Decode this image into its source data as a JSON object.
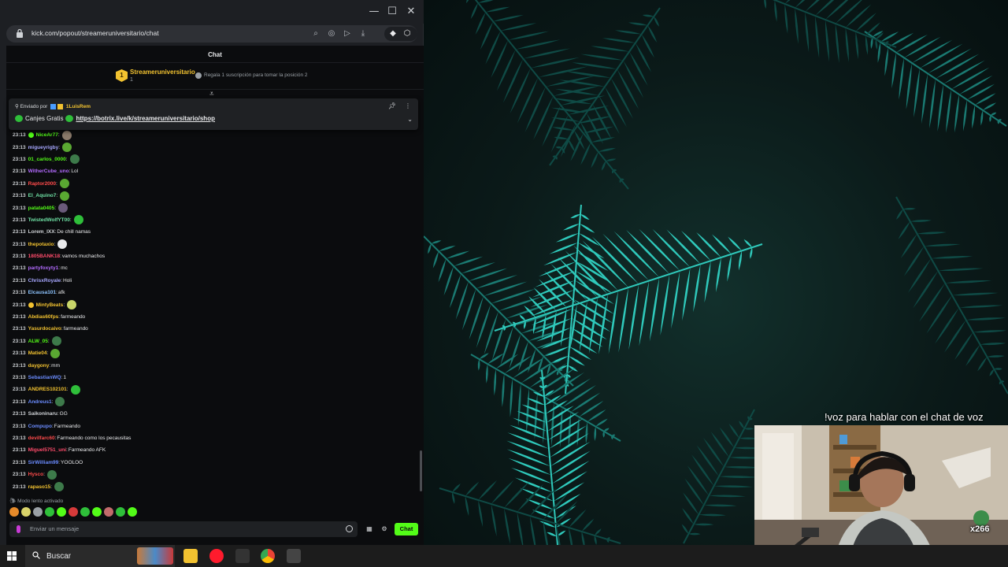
{
  "window": {
    "minimize_glyph": "—",
    "maximize_glyph": "☐",
    "close_glyph": "✕",
    "url": "kick.com/popout/streameruniversitario/chat"
  },
  "chat": {
    "title": "Chat",
    "leaderboard": {
      "rank": "1",
      "name": "Streameruniversitario",
      "count": "1",
      "gift_text": "Regala 1 suscripción para tomar la posición 2"
    },
    "pinned": {
      "sent_by": "Enviado por",
      "user": "1LuisRem",
      "label": "Canjes Gratis",
      "link": "https://botrix.live/k/streameruniversitario/shop"
    },
    "messages": [
      {
        "time": "23:13",
        "user": "NiceAr77",
        "text": "",
        "color": "#53fc18",
        "emote": "#8a7a6a",
        "badge": "#53fc18"
      },
      {
        "time": "23:13",
        "user": "migueyrigby",
        "text": "",
        "color": "#a7a7ff",
        "emote": "#5aa832"
      },
      {
        "time": "23:13",
        "user": "01_carlos_0000",
        "text": "",
        "color": "#53fc18",
        "emote": "#3d7a4a"
      },
      {
        "time": "23:13",
        "user": "WitherCube_uno",
        "text": "Lol",
        "color": "#b36bff",
        "emote": ""
      },
      {
        "time": "23:13",
        "user": "Raptor2000",
        "text": "",
        "color": "#ff4b4b",
        "emote": "#5aa832"
      },
      {
        "time": "23:13",
        "user": "El_Aquino7",
        "text": "",
        "color": "#6fe2a5",
        "emote": "#5aa832"
      },
      {
        "time": "23:13",
        "user": "patata0405",
        "text": "",
        "color": "#53fc18",
        "emote": "#6a5a7a"
      },
      {
        "time": "23:13",
        "user": "TwistedWolfYT00",
        "text": "",
        "color": "#6fe2a5",
        "emote": "#2fbf3a"
      },
      {
        "time": "23:13",
        "user": "Lorem_IXX",
        "text": "De chill namas",
        "color": "#cfd2d6",
        "emote": ""
      },
      {
        "time": "23:13",
        "user": "thepotaxio",
        "text": "",
        "color": "#f2c230",
        "emote": "#e9eaec"
      },
      {
        "time": "23:13",
        "user": "1805BANK18",
        "text": "vamos muchachos",
        "color": "#ff4b6b",
        "emote": ""
      },
      {
        "time": "23:13",
        "user": "partyfoxyty1",
        "text": "mc",
        "color": "#b36bff",
        "emote": ""
      },
      {
        "time": "23:13",
        "user": "ChrisxRoyale",
        "text": "Holi",
        "color": "#a7a7ff",
        "emote": ""
      },
      {
        "time": "23:13",
        "user": "Elcausa101",
        "text": "afk",
        "color": "#8ec5ff",
        "emote": ""
      },
      {
        "time": "23:13",
        "user": "MintyBeats",
        "text": "",
        "color": "#f2c230",
        "emote": "#c9d66a",
        "badge": "#f2c230"
      },
      {
        "time": "23:13",
        "user": "Abdias60fps",
        "text": "farmeando",
        "color": "#f2c230",
        "emote": ""
      },
      {
        "time": "23:13",
        "user": "Yasurdocaivo",
        "text": "farmeando",
        "color": "#f2c230",
        "emote": ""
      },
      {
        "time": "23:13",
        "user": "ALW_05",
        "text": "",
        "color": "#53fc18",
        "emote": "#3d7a4a"
      },
      {
        "time": "23:13",
        "user": "Matie04",
        "text": "",
        "color": "#f2c230",
        "emote": "#5aa832"
      },
      {
        "time": "23:13",
        "user": "daygony",
        "text": "mm",
        "color": "#f2c230",
        "emote": ""
      },
      {
        "time": "23:13",
        "user": "SebastianWQ",
        "text": "1",
        "color": "#6b8cff",
        "emote": ""
      },
      {
        "time": "23:13",
        "user": "ANDRES102101",
        "text": "",
        "color": "#f2c230",
        "emote": "#2fbf3a"
      },
      {
        "time": "23:13",
        "user": "Andreus1",
        "text": "",
        "color": "#6b8cff",
        "emote": "#3d7a4a"
      },
      {
        "time": "23:13",
        "user": "Saikoninaru",
        "text": "GG",
        "color": "#cfd2d6",
        "emote": ""
      },
      {
        "time": "23:13",
        "user": "Compupo",
        "text": "Farmeando",
        "color": "#6b8cff",
        "emote": ""
      },
      {
        "time": "23:13",
        "user": "devilfarc60",
        "text": "Farmeando como los pecausitas",
        "color": "#ff4b4b",
        "emote": ""
      },
      {
        "time": "23:13",
        "user": "Miguel5751_uni",
        "text": "Farmeando AFK",
        "color": "#ff4b6b",
        "emote": ""
      },
      {
        "time": "23:13",
        "user": "SirWilliam99",
        "text": "YOOLOO",
        "color": "#6b8cff",
        "emote": ""
      },
      {
        "time": "23:13",
        "user": "Hysco",
        "text": "",
        "color": "#ff4b4b",
        "emote": "#3d7a4a"
      },
      {
        "time": "23:13",
        "user": "rapaso15",
        "text": "",
        "color": "#f2c230",
        "emote": "#3d7a4a"
      }
    ],
    "slow_mode": "Modo lento activado",
    "input_placeholder": "Enviar un mensaje",
    "send_label": "Chat",
    "emote_colors": [
      "#e58a2a",
      "#d9d36a",
      "#9aa0a6",
      "#2fbf3a",
      "#53fc18",
      "#d63a3a",
      "#2fbf3a",
      "#53fc18",
      "#c26b6b",
      "#2fbf3a",
      "#53fc18"
    ]
  },
  "stream": {
    "caption": "!voz para hablar con el chat de voz",
    "counter": "x266"
  },
  "taskbar": {
    "search_label": "Buscar"
  },
  "colors": {
    "kick_green": "#53fc18",
    "chat_bg": "#0b0c0e",
    "taskbar_bg": "#1c1c1c"
  }
}
